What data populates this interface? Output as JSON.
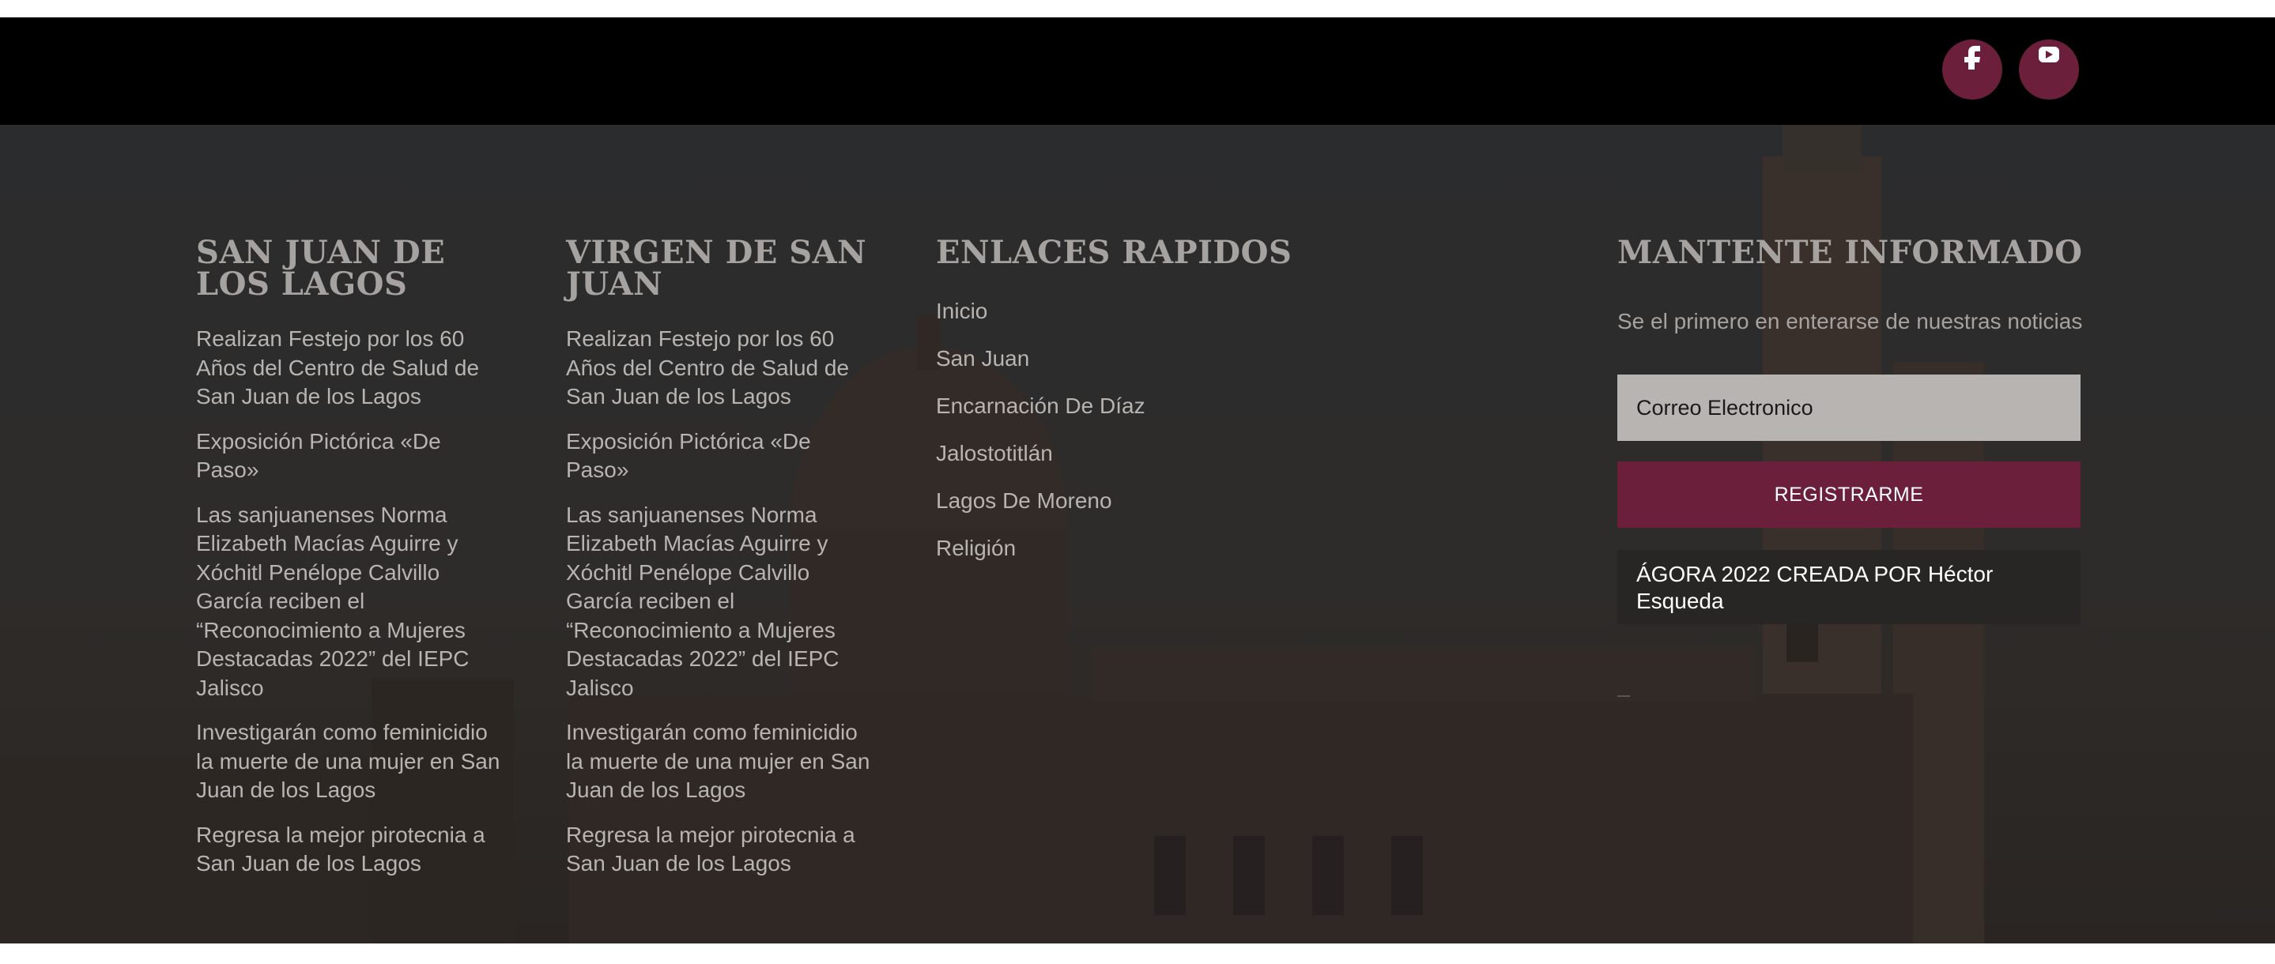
{
  "topbar": {
    "social": [
      {
        "name": "facebook-icon",
        "color": "#6b1f3b"
      },
      {
        "name": "youtube-icon",
        "color": "#6b1f3b"
      }
    ]
  },
  "footer": {
    "col1": {
      "title": "SAN JUAN DE LOS LAGOS",
      "posts": [
        "Realizan Festejo por los 60 Años del Centro de Salud de San Juan de los Lagos",
        "Exposición Pictórica «De Paso»",
        "Las sanjuanenses Norma Elizabeth Macías Aguirre y Xóchitl Penélope Calvillo García reciben el “Reconocimiento a Mujeres Destacadas 2022” del IEPC Jalisco",
        "Investigarán como feminicidio la muerte de una mujer en San Juan de los Lagos",
        "Regresa la mejor pirotecnia a San Juan de los Lagos"
      ]
    },
    "col2": {
      "title": "VIRGEN DE SAN JUAN",
      "posts": [
        "Realizan Festejo por los 60 Años del Centro de Salud de San Juan de los Lagos",
        "Exposición Pictórica «De Paso»",
        "Las sanjuanenses Norma Elizabeth Macías Aguirre y Xóchitl Penélope Calvillo García reciben el “Reconocimiento a Mujeres Destacadas 2022” del IEPC Jalisco",
        "Investigarán como feminicidio la muerte de una mujer en San Juan de los Lagos",
        "Regresa la mejor pirotecnia a San Juan de los Lagos"
      ]
    },
    "col3": {
      "title": "ENLACES RAPIDOS",
      "links": [
        "Inicio",
        "San Juan",
        "Encarnación De Díaz",
        "Jalostotitlán",
        "Lagos De Moreno",
        "Religión"
      ]
    },
    "col4": {
      "title": "MANTENTE INFORMADO",
      "text": "Se el primero en enterarse de nuestras noticias",
      "email_placeholder": "Correo Electronico",
      "register_label": "REGISTRARME",
      "credit": "ÁGORA 2022 CREADA POR Héctor Esqueda"
    },
    "colors": {
      "accent": "#6b1f3b",
      "overlay": "#2c2a28",
      "heading": "#a6a2a0",
      "link": "#b8b4b1"
    }
  }
}
